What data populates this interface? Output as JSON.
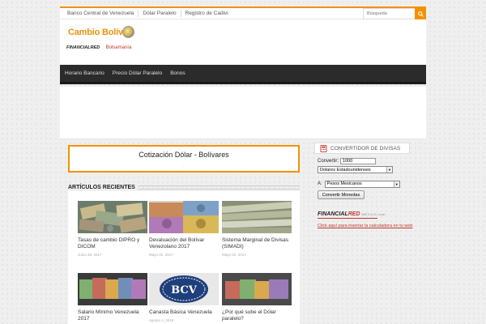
{
  "topbar": {
    "links": [
      "Banco Central de Venezuela",
      "Dólar Paralelo",
      "Registro de Cadivi"
    ],
    "search_placeholder": "Búsqueda"
  },
  "header": {
    "logo_text": "Cambio Bolívar",
    "partner1": "FINANCIALRED",
    "partner2": "Bolsamanía"
  },
  "mainnav": {
    "items": [
      "Horario Bancario",
      "Precio Dólar Paralelo",
      "Bonos"
    ]
  },
  "cotizacion": {
    "title": "Cotización Dólar - Bolívares",
    "dot": "."
  },
  "recent": {
    "heading": "ARTÍCULOS RECIENTES",
    "articles": [
      {
        "title": "Tasas de cambio DIPRO y DICOM",
        "date": "Junio 28, 2017"
      },
      {
        "title": "Devaluación del Bolívar Venezolano 2017",
        "date": "Mayo 31, 2017"
      },
      {
        "title": "Sistema Marginal de Divisas (SIMADI)",
        "date": "Mayo 02, 2017"
      },
      {
        "title": "Salario Mínimo Venezuela 2017",
        "date": ""
      },
      {
        "title": "Canasta Básica Venezuela",
        "date": "Agosto 4, 2016"
      },
      {
        "title": "¿Por qué sube el Dólar paralelo?",
        "date": ""
      }
    ],
    "bcv_badge": "BCV"
  },
  "sidebar": {
    "heading": "Convertidor de Divisas",
    "convert_label": "Convertir:",
    "amount": "1000",
    "from_currency": "Dolares Estadounidenses",
    "to_label": "A:",
    "to_currency": "Pesos Mexicanos",
    "button": "Convertir Monedas",
    "brand_main": "FINANCIAL",
    "brand_accent": "RED",
    "brand_suffix": "MÉXICO.com",
    "link_text": "Click aquí para insertar la calculadora en tu web"
  },
  "colors": {
    "accent": "#f39200",
    "nav_bg": "#2b2b2b",
    "link": "#c0392b"
  }
}
